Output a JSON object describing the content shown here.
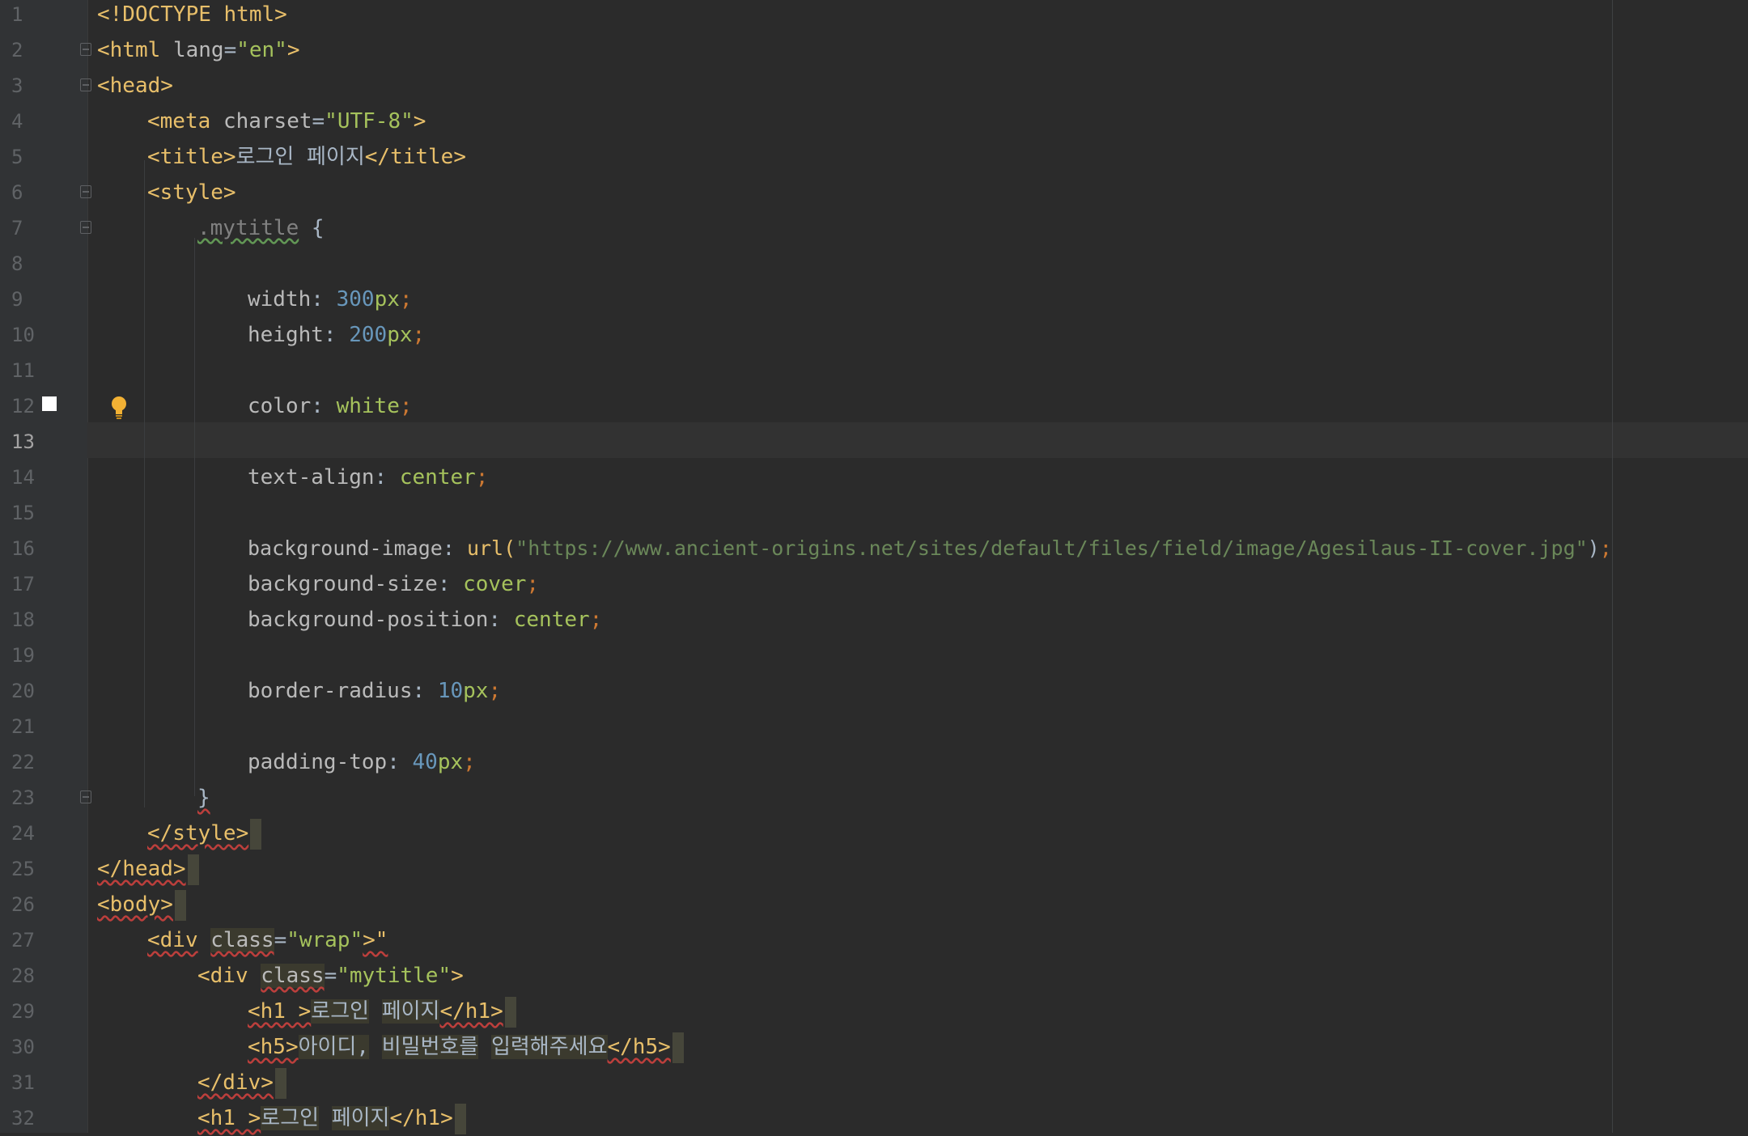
{
  "editor": {
    "line_numbers": [
      "1",
      "2",
      "3",
      "4",
      "5",
      "6",
      "7",
      "8",
      "9",
      "10",
      "11",
      "12",
      "13",
      "14",
      "15",
      "16",
      "17",
      "18",
      "19",
      "20",
      "21",
      "22",
      "23",
      "24",
      "25",
      "26",
      "27",
      "28",
      "29",
      "30",
      "31",
      "32"
    ],
    "current_line": "13",
    "icons": {
      "breakpoint": "gutter-marker-square",
      "intention": "lightbulb-icon",
      "fold": "fold-marker-icon"
    },
    "lines": {
      "l1": {
        "doctype": "<!DOCTYPE html>"
      },
      "l2": {
        "open": "<html",
        "attr": "lang",
        "eq": "=",
        "val": "\"en\"",
        "close": ">"
      },
      "l3": {
        "tag": "<head>"
      },
      "l4": {
        "open": "<meta",
        "attr": "charset",
        "eq": "=",
        "val": "\"UTF-8\"",
        "close": ">"
      },
      "l5": {
        "open": "<title>",
        "text": "로그인 페이지",
        "close": "</title>"
      },
      "l6": {
        "tag": "<style>"
      },
      "l7": {
        "selector": ".mytitle",
        "brace": " {"
      },
      "l9": {
        "prop": "width",
        "colon": ": ",
        "num": "300",
        "unit": "px",
        "semi": ";"
      },
      "l10": {
        "prop": "height",
        "colon": ": ",
        "num": "200",
        "unit": "px",
        "semi": ";"
      },
      "l12": {
        "prop": "color",
        "colon": ": ",
        "val": "white",
        "semi": ";"
      },
      "l14": {
        "prop": "text-align",
        "colon": ": ",
        "val": "center",
        "semi": ";"
      },
      "l16": {
        "prop": "background-image",
        "colon": ": ",
        "fn": "url(",
        "str": "\"https://www.ancient-origins.net/sites/default/files/field/image/Agesilaus-II-cover.jpg\"",
        "close": ")",
        "semi": ";"
      },
      "l17": {
        "prop": "background-size",
        "colon": ": ",
        "val": "cover",
        "semi": ";"
      },
      "l18": {
        "prop": "background-position",
        "colon": ": ",
        "val": "center",
        "semi": ";"
      },
      "l20": {
        "prop": "border-radius",
        "colon": ": ",
        "num": "10",
        "unit": "px",
        "semi": ";"
      },
      "l22": {
        "prop": "padding-top",
        "colon": ": ",
        "num": "40",
        "unit": "px",
        "semi": ";"
      },
      "l23": {
        "brace": "}"
      },
      "l24": {
        "tag": "</style>"
      },
      "l25": {
        "tag": "</head>"
      },
      "l26": {
        "tag": "<body>"
      },
      "l27": {
        "open": "<div",
        "sp": " ",
        "attr": "class",
        "eq": "=",
        "val": "\"wrap\"",
        "tail": ">\""
      },
      "l28": {
        "open": "<div",
        "sp": " ",
        "attr": "class",
        "eq": "=",
        "val": "\"mytitle\"",
        "close": ">"
      },
      "l29": {
        "open": "<h1 >",
        "w1": "로그인",
        "sp": " ",
        "w2": "페이지",
        "close": "</h1>"
      },
      "l30": {
        "open": "<h5>",
        "w1": "아이디,",
        "sp1": " ",
        "w2": "비밀번호를",
        "sp2": " ",
        "w3": "입력해주세요",
        "close": "</h5>"
      },
      "l31": {
        "tag": "</div>"
      },
      "l32": {
        "open": "<h1 >",
        "w1": "로그인",
        "sp": " ",
        "w2": "페이지",
        "close": "</h1>"
      }
    }
  }
}
